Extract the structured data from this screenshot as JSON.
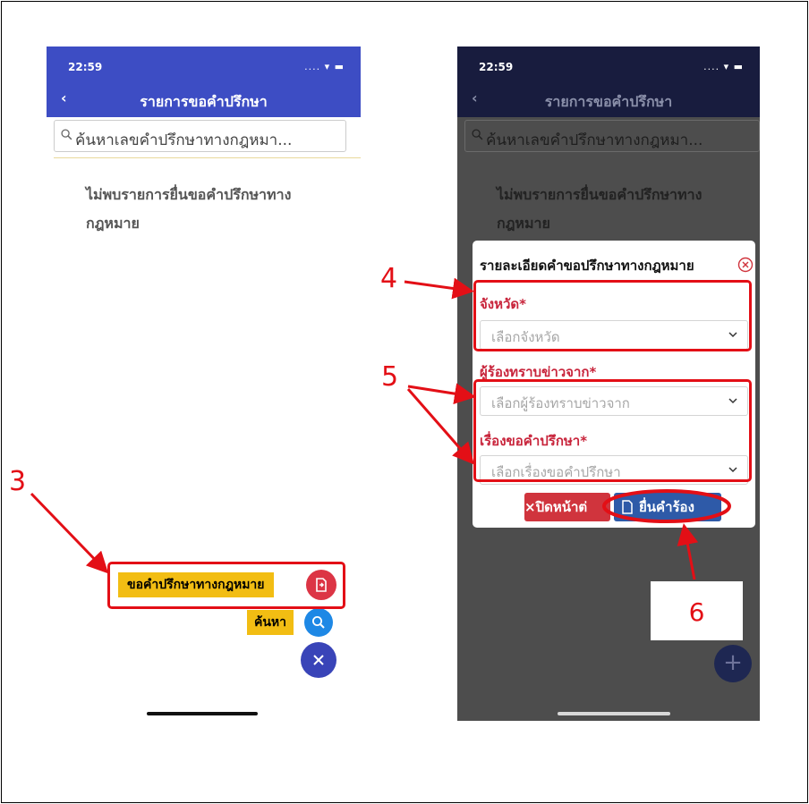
{
  "colors": {
    "appbar": "#3d4dc4",
    "appbar_dimmed": "#181c3e",
    "fab_label": "#f2bd13",
    "annotation": "#e30f16",
    "field_label": "#c8243b",
    "button_close": "#d0343d",
    "button_submit": "#2e5aa8"
  },
  "phone_left": {
    "status_time": "22:59",
    "title": "รายการขอคำปรึกษา",
    "search_placeholder": "ค้นหาเลขคำปรึกษาทางกฎหมา...",
    "empty_message": "ไม่พบรายการยื่นขอคำปรึกษาทางกฎหมาย",
    "fab_request_label": "ขอคำปรึกษาทางกฎหมาย",
    "fab_search_label": "ค้นหา",
    "icons": {
      "request": "document-edit-icon",
      "search": "search-icon",
      "close": "close-icon"
    }
  },
  "phone_right": {
    "status_time": "22:59",
    "title": "รายการขอคำปรึกษา",
    "search_placeholder": "ค้นหาเลขคำปรึกษาทางกฎหมา...",
    "empty_message": "ไม่พบรายการยื่นขอคำปรึกษาทางกฎหมาย",
    "fab_icon": "plus-icon",
    "dialog": {
      "title": "รายละเอียดคำขอปรึกษาทางกฎหมาย",
      "province_label": "จังหวัด*",
      "province_placeholder": "เลือกจังหวัด",
      "source_label": "ผู้ร้องทราบข่าวจาก*",
      "source_placeholder": "เลือกผู้ร้องทราบข่าวจาก",
      "topic_label": "เรื่องขอคำปรึกษา*",
      "topic_placeholder": "เลือกเรื่องขอคำปรึกษา",
      "close_button": "×ปิดหน้าต่",
      "submit_button": "ยื่นคำร้อง"
    }
  },
  "annotations": {
    "step3": "3",
    "step4": "4",
    "step5": "5",
    "step6": "6"
  }
}
